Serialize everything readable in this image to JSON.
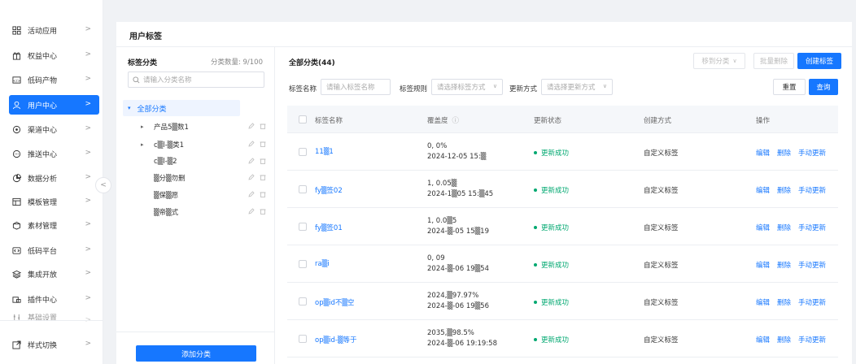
{
  "sidebar": {
    "items": [
      {
        "label": "活动应用",
        "icon": "grid-icon",
        "name": "sidebar-item-activity"
      },
      {
        "label": "权益中心",
        "icon": "gift-icon",
        "name": "sidebar-item-rights"
      },
      {
        "label": "低码产物",
        "icon": "code-box-icon",
        "name": "sidebar-item-lowcode-products"
      },
      {
        "label": "用户中心",
        "icon": "user-icon",
        "name": "sidebar-item-user-center",
        "active": true
      },
      {
        "label": "渠道中心",
        "icon": "channel-icon",
        "name": "sidebar-item-channel"
      },
      {
        "label": "推送中心",
        "icon": "chat-icon",
        "name": "sidebar-item-push"
      },
      {
        "label": "数据分析",
        "icon": "pie-chart-icon",
        "name": "sidebar-item-data-analysis"
      },
      {
        "label": "模板管理",
        "icon": "template-icon",
        "name": "sidebar-item-templates"
      },
      {
        "label": "素材管理",
        "icon": "package-icon",
        "name": "sidebar-item-materials"
      },
      {
        "label": "低码平台",
        "icon": "code-icon",
        "name": "sidebar-item-lowcode-platform"
      },
      {
        "label": "集成开放",
        "icon": "layers-icon",
        "name": "sidebar-item-integration"
      },
      {
        "label": "插件中心",
        "icon": "plugin-icon",
        "name": "sidebar-item-plugins"
      },
      {
        "label": "基础设置",
        "icon": "settings-icon",
        "name": "sidebar-item-basic-settings"
      },
      {
        "label": "样式切换",
        "icon": "style-icon",
        "name": "sidebar-item-style-switch"
      }
    ],
    "arrow": ">",
    "collapse": "<"
  },
  "panel": {
    "title": "用户标签"
  },
  "category": {
    "title": "标签分类",
    "count": "分类数量: 9/100",
    "search_placeholder": "请输入分类名称",
    "root": "全部分类",
    "nodes": [
      {
        "label": "产品5▒数1",
        "expandable": true
      },
      {
        "label": "c▒l-▒类1",
        "expandable": true
      },
      {
        "label": "c▒l-▒2",
        "expandable": false
      },
      {
        "label": "▒分▒勿删",
        "expandable": false
      },
      {
        "label": "▒保▒愿",
        "expandable": false
      },
      {
        "label": "▒帝▒式",
        "expandable": false
      }
    ],
    "add_button": "添加分类"
  },
  "list": {
    "title": "全部分类(44)",
    "move_button": "移到分类",
    "batch_delete": "批量删除",
    "create_button": "创建标签",
    "filters": {
      "name_label": "标签名称",
      "name_placeholder": "请输入标签名称",
      "rule_label": "标签规则",
      "rule_placeholder": "请选择标签方式",
      "update_label": "更新方式",
      "update_placeholder": "请选择更新方式"
    },
    "reset_button": "重置",
    "query_button": "查询",
    "columns": [
      "标签名称",
      "覆盖度",
      "更新状态",
      "创建方式",
      "操作"
    ],
    "rows": [
      {
        "name": "11▒1",
        "cov1": "0, 0%",
        "cov2": "2024-12-05 15:▒",
        "status": "更新成功",
        "method": "自定义标签"
      },
      {
        "name": "fy▒签02",
        "cov1": "1, 0.05▒",
        "cov2": "2024-1▒05 15:▒45",
        "status": "更新成功",
        "method": "自定义标签"
      },
      {
        "name": "fy▒签01",
        "cov1": "1, 0.0▒5",
        "cov2": "2024-▒-05 15▒19",
        "status": "更新成功",
        "method": "自定义标签"
      },
      {
        "name": "ra▒i",
        "cov1": "0, 09",
        "cov2": "2024-▒-06 19▒54",
        "status": "更新成功",
        "method": "自定义标签"
      },
      {
        "name": "op▒id不▒空",
        "cov1": "2024,▒97.97%",
        "cov2": "2024-▒-06 19▒56",
        "status": "更新成功",
        "method": "自定义标签"
      },
      {
        "name": "op▒id-▒等于",
        "cov1": "2035,▒98.5%",
        "cov2": "2024-▒-06 19:19:58",
        "status": "更新成功",
        "method": "自定义标签"
      }
    ],
    "row_actions": {
      "edit": "编辑",
      "delete": "删除",
      "manual": "手动更新"
    }
  },
  "colors": {
    "primary": "#1677ff",
    "success": "#00a870"
  }
}
